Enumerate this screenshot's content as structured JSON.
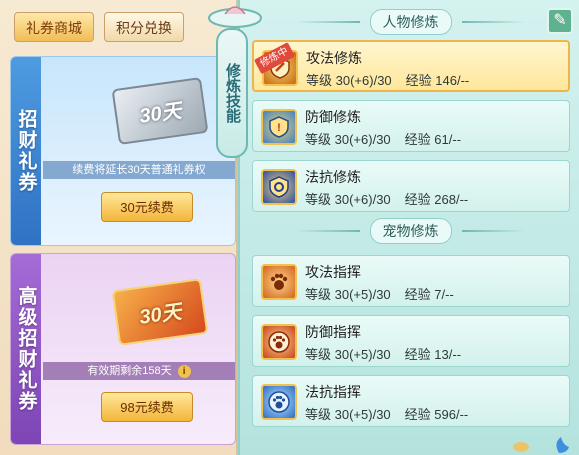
{
  "shop": {
    "tabs": [
      {
        "label": "礼券商城",
        "active": true
      },
      {
        "label": "积分兑换",
        "active": false
      }
    ],
    "cards": [
      {
        "side_label": "招财礼券",
        "ticket_text": "30天",
        "note": "续费将延长30天普通礼券权",
        "button": "30元续费"
      },
      {
        "side_label": "高级招财礼券",
        "ticket_text": "30天",
        "note": "有效期剩余158天",
        "info_icon": "i",
        "button": "98元续费"
      }
    ]
  },
  "ribbon": {
    "label": "修炼技能"
  },
  "cultivation": {
    "character_section": "人物修炼",
    "pet_section": "宠物修炼",
    "level_label": "等级",
    "exp_label": "经验",
    "training_badge": "修炼中",
    "character_skills": [
      {
        "name": "攻法修炼",
        "level": "30(+6)/30",
        "exp": "146/--",
        "icon": "attack-shield-icon",
        "selected": true
      },
      {
        "name": "防御修炼",
        "level": "30(+6)/30",
        "exp": "61/--",
        "icon": "defense-shield-icon",
        "selected": false
      },
      {
        "name": "法抗修炼",
        "level": "30(+6)/30",
        "exp": "268/--",
        "icon": "resist-shield-icon",
        "selected": false
      }
    ],
    "pet_skills": [
      {
        "name": "攻法指挥",
        "level": "30(+5)/30",
        "exp": "7/--",
        "icon": "attack-paw-icon"
      },
      {
        "name": "防御指挥",
        "level": "30(+5)/30",
        "exp": "13/--",
        "icon": "defense-paw-icon"
      },
      {
        "name": "法抗指挥",
        "level": "30(+5)/30",
        "exp": "596/--",
        "icon": "resist-paw-icon"
      }
    ]
  },
  "colors": {
    "accent_gold": "#f3b53b",
    "panel_teal": "#b4e3de",
    "training_red": "#e0493b"
  }
}
